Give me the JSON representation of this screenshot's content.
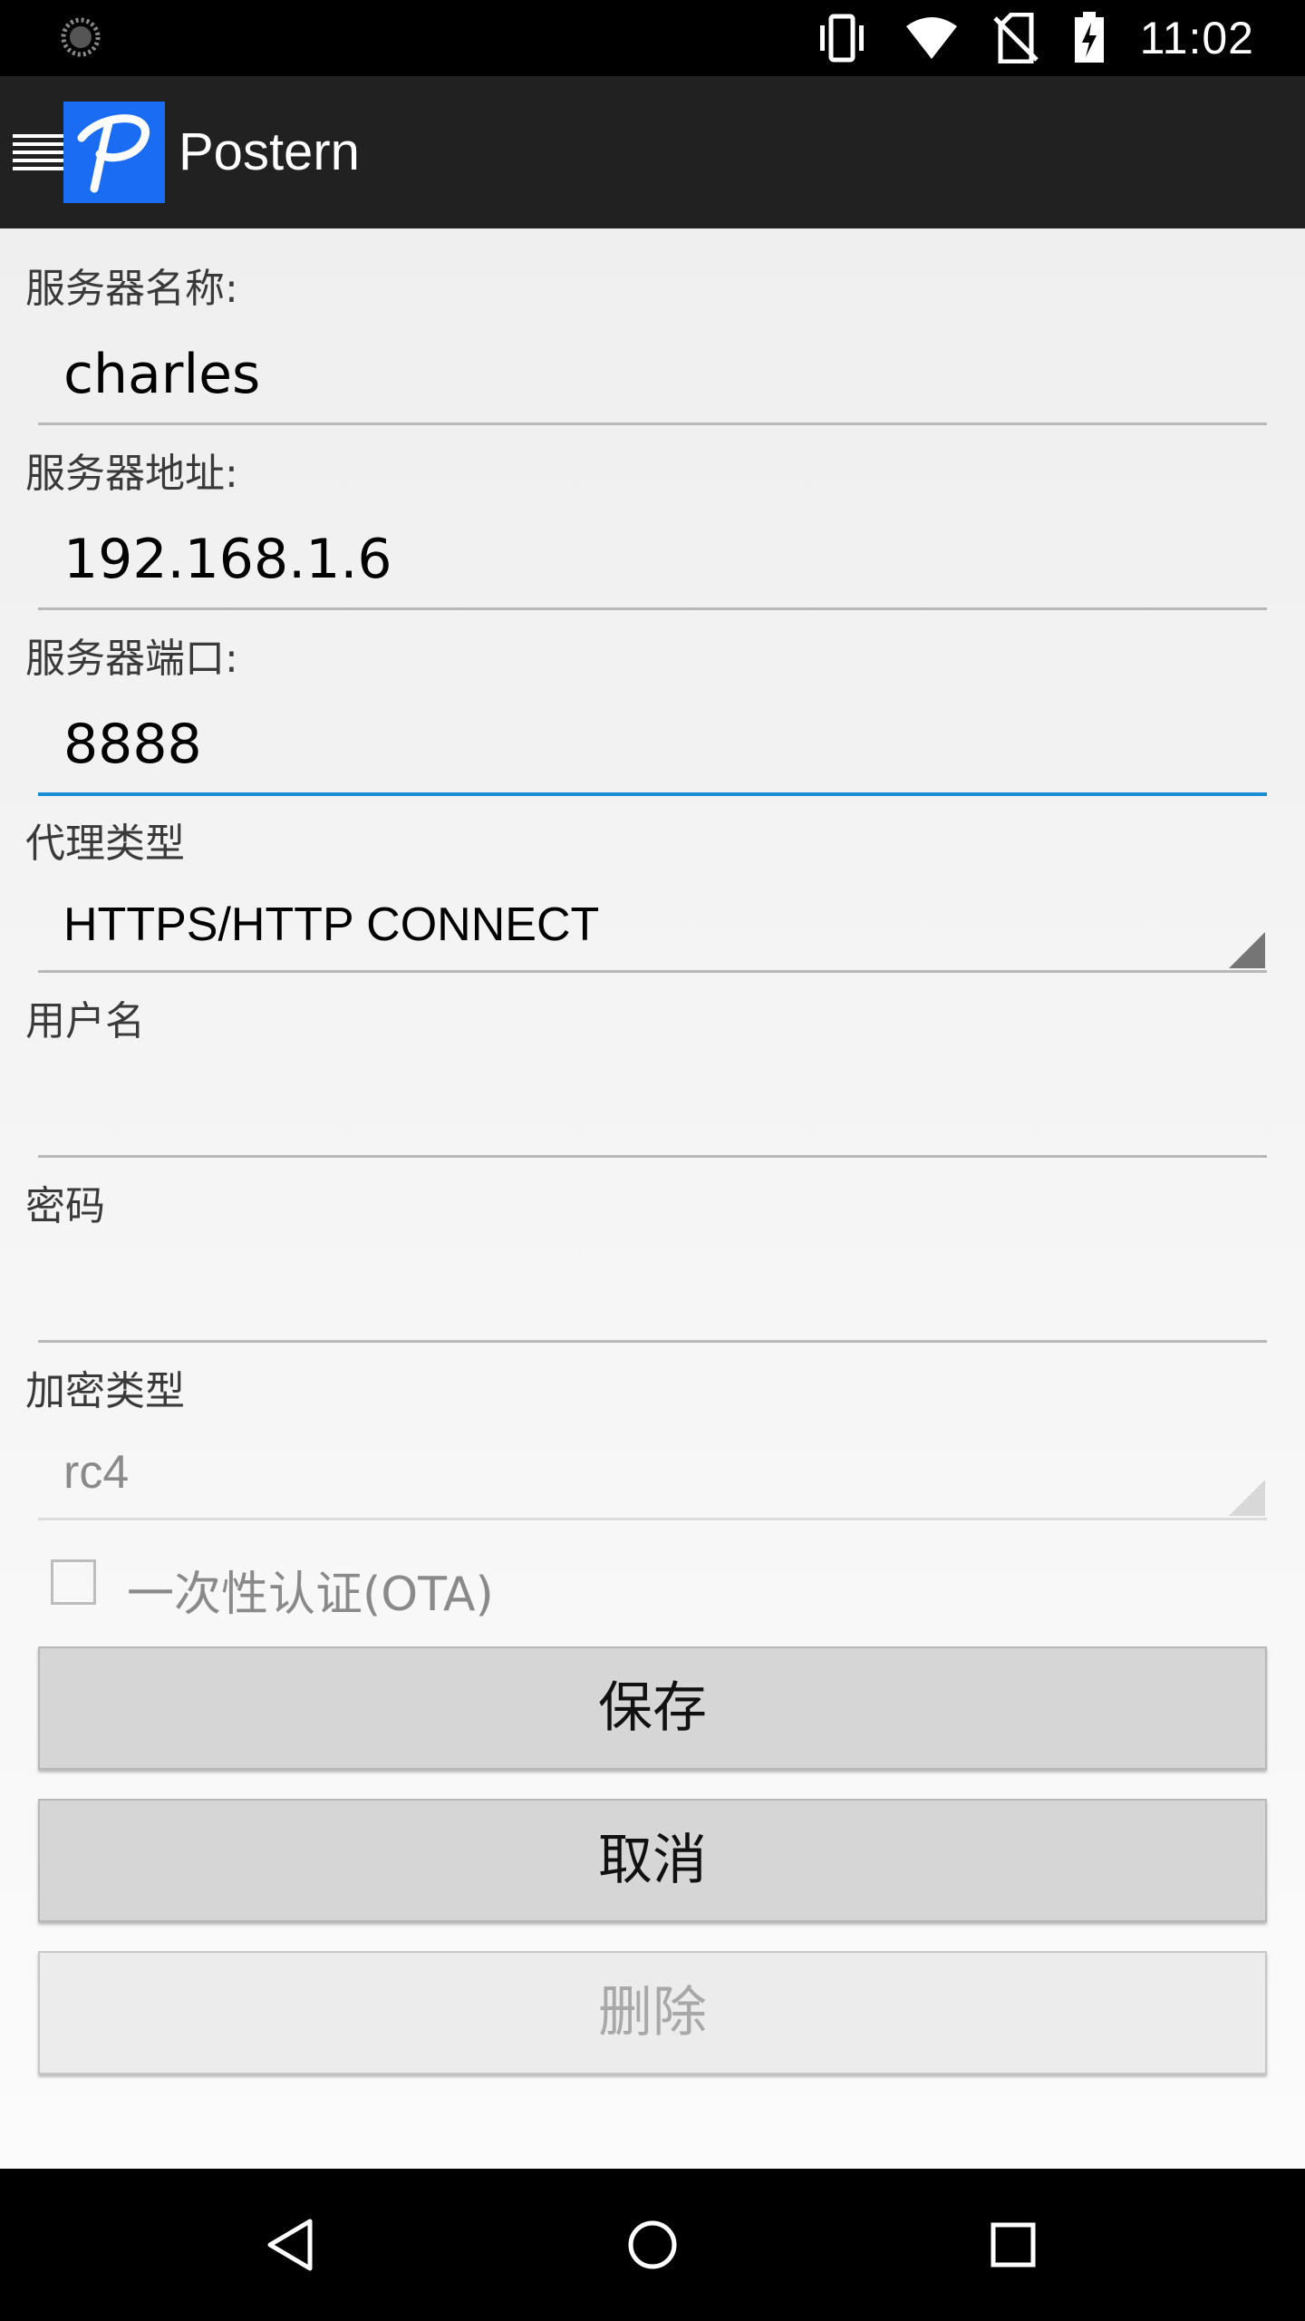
{
  "status_bar": {
    "time": "11:02",
    "icons": [
      "loading-spinner-icon",
      "vibrate-icon",
      "wifi-icon",
      "no-sim-icon",
      "battery-charging-icon"
    ]
  },
  "app_bar": {
    "title": "Postern",
    "logo_letter": "P",
    "colors": {
      "bar": "#212121",
      "logo": "#1a6df2"
    }
  },
  "form": {
    "server_name": {
      "label": "服务器名称:",
      "value": "charles"
    },
    "server_address": {
      "label": "服务器地址:",
      "value": "192.168.1.6"
    },
    "server_port": {
      "label": "服务器端口:",
      "value": "8888"
    },
    "proxy_type": {
      "label": "代理类型",
      "value": "HTTPS/HTTP CONNECT"
    },
    "username": {
      "label": "用户名",
      "value": ""
    },
    "password": {
      "label": "密码",
      "value": ""
    },
    "encryption_type": {
      "label": "加密类型",
      "value": "rc4"
    },
    "ota_checkbox": {
      "label": "一次性认证(OTA)",
      "checked": false
    }
  },
  "buttons": {
    "save": "保存",
    "cancel": "取消",
    "delete": "删除"
  },
  "accent_color": "#1a8fd6",
  "nav_bar": {
    "icons": [
      "back-icon",
      "home-icon",
      "recents-icon"
    ]
  }
}
